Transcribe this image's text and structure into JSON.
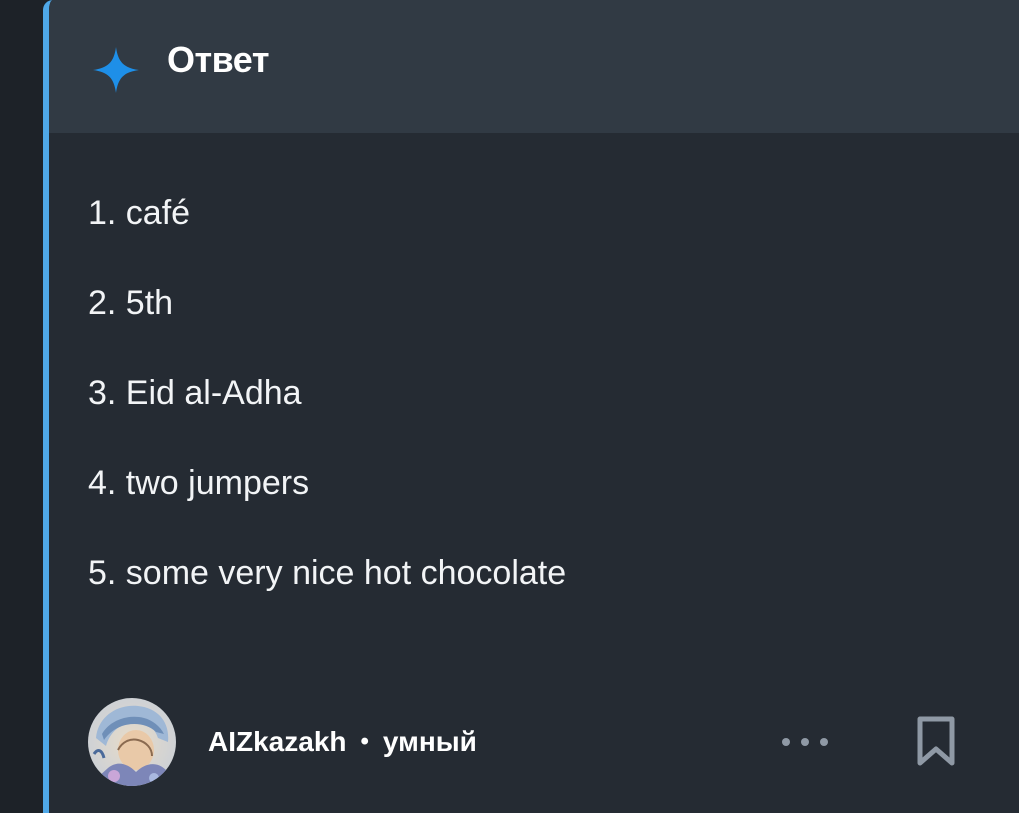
{
  "header": {
    "title": "Ответ",
    "icon": "sparkle-icon",
    "icon_color": "#1e8fe8"
  },
  "answers": [
    "1. café",
    "2. 5th",
    "3. Eid al-Adha",
    "4. two jumpers",
    "5. some very nice hot chocolate"
  ],
  "footer": {
    "username": "AIZkazakh",
    "separator": "•",
    "rank": "умный",
    "more_icon": "more-options-icon",
    "bookmark_icon": "bookmark-icon"
  },
  "colors": {
    "accent_border": "#4fa8e8",
    "card_background": "#252b33",
    "header_background": "#313a44"
  }
}
